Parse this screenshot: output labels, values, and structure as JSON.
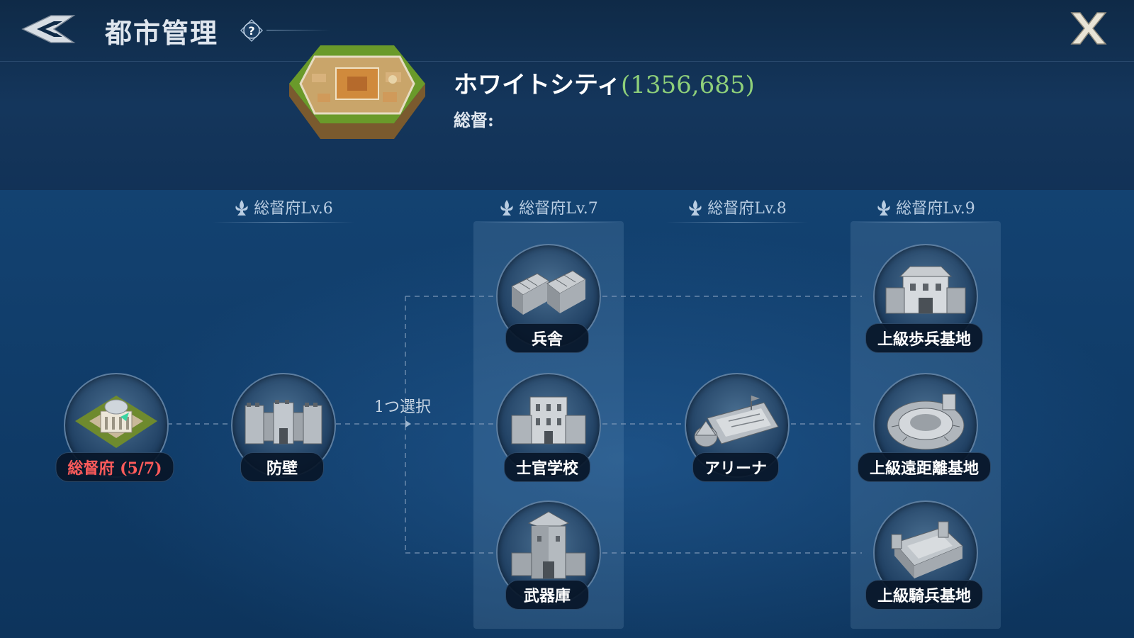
{
  "header": {
    "title": "都市管理",
    "help_icon": "question-mark-icon",
    "close_label": "X"
  },
  "city": {
    "name": "ホワイトシティ",
    "coords": "(1356,685)",
    "governor_label": "総督:",
    "coords_color": "#8fd07a"
  },
  "tiers": [
    {
      "label": "総督府Lv.6"
    },
    {
      "label": "総督府Lv.7"
    },
    {
      "label": "総督府Lv.8"
    },
    {
      "label": "総督府Lv.9"
    }
  ],
  "branch_label": "1つ選択",
  "buildings": {
    "governor_office": {
      "label": "総督府 (5/7)",
      "color": "#ff5b5b"
    },
    "wall": {
      "label": "防壁"
    },
    "barracks": {
      "label": "兵舎"
    },
    "officer_school": {
      "label": "士官学校"
    },
    "armory": {
      "label": "武器庫"
    },
    "arena": {
      "label": "アリーナ"
    },
    "adv_infantry": {
      "label": "上級歩兵基地"
    },
    "adv_ranged": {
      "label": "上級遠距離基地"
    },
    "adv_cavalry": {
      "label": "上級騎兵基地"
    }
  }
}
